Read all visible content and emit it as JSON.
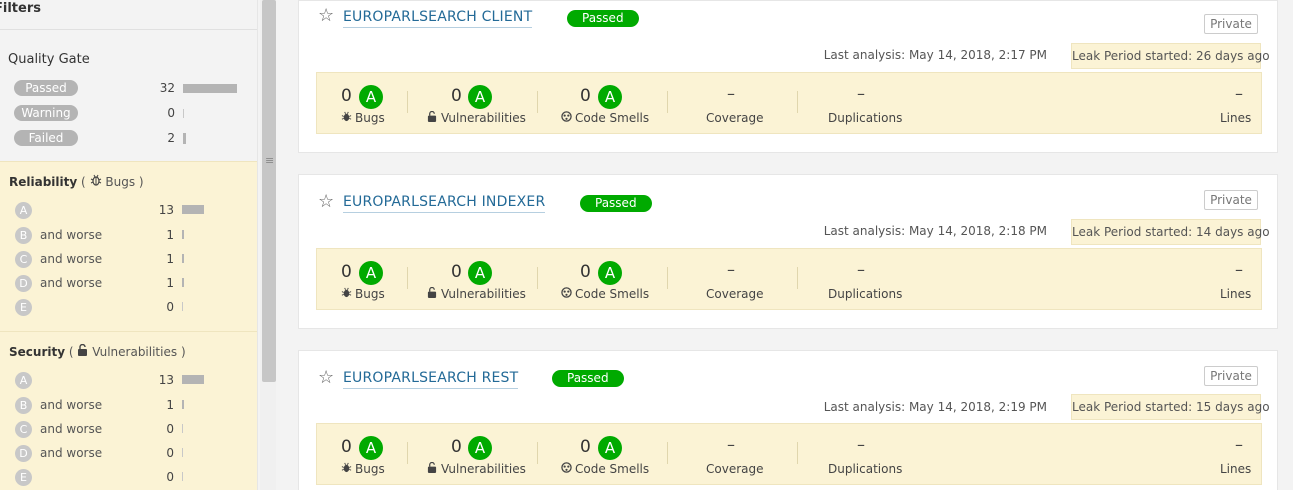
{
  "sidebar": {
    "filters_title": "Filters",
    "quality_gate": {
      "title": "Quality Gate",
      "items": [
        {
          "label": "Passed",
          "count": "32",
          "fraction": 1.0
        },
        {
          "label": "Warning",
          "count": "0",
          "fraction": 0.0
        },
        {
          "label": "Failed",
          "count": "2",
          "fraction": 0.06
        }
      ]
    },
    "reliability": {
      "title": "Reliability",
      "paren_open": "(",
      "sub": "Bugs",
      "paren_close": ")",
      "icon": "bug-icon",
      "rows": [
        {
          "grade": "A",
          "label": "",
          "count": "13",
          "fraction": 1.0
        },
        {
          "grade": "B",
          "label": "and worse",
          "count": "1",
          "fraction": 0.08
        },
        {
          "grade": "C",
          "label": "and worse",
          "count": "1",
          "fraction": 0.08
        },
        {
          "grade": "D",
          "label": "and worse",
          "count": "1",
          "fraction": 0.08
        },
        {
          "grade": "E",
          "label": "",
          "count": "0",
          "fraction": 0.0
        }
      ]
    },
    "security": {
      "title": "Security",
      "paren_open": "(",
      "sub": "Vulnerabilities",
      "paren_close": ")",
      "icon": "lock-icon",
      "rows": [
        {
          "grade": "A",
          "label": "",
          "count": "13",
          "fraction": 1.0
        },
        {
          "grade": "B",
          "label": "and worse",
          "count": "1",
          "fraction": 0.08
        },
        {
          "grade": "C",
          "label": "and worse",
          "count": "0",
          "fraction": 0.0
        },
        {
          "grade": "D",
          "label": "and worse",
          "count": "0",
          "fraction": 0.0
        },
        {
          "grade": "E",
          "label": "",
          "count": "0",
          "fraction": 0.0
        }
      ]
    }
  },
  "projects": [
    {
      "name": "EUROPARLSEARCH CLIENT",
      "status": "Passed",
      "visibility": "Private",
      "last_analysis": "Last analysis: May 14, 2018, 2:17 PM",
      "leak_period": "Leak Period started: 26 days ago",
      "bugs": "0",
      "bugs_grade": "A",
      "bugs_label": "Bugs",
      "vulns": "0",
      "vulns_grade": "A",
      "vulns_label": "Vulnerabilities",
      "smells": "0",
      "smells_grade": "A",
      "smells_label": "Code Smells",
      "coverage": "–",
      "coverage_label": "Coverage",
      "duplications": "–",
      "duplications_label": "Duplications",
      "lines": "–",
      "lines_label": "Lines"
    },
    {
      "name": "EUROPARLSEARCH INDEXER",
      "status": "Passed",
      "visibility": "Private",
      "last_analysis": "Last analysis: May 14, 2018, 2:18 PM",
      "leak_period": "Leak Period started: 14 days ago",
      "bugs": "0",
      "bugs_grade": "A",
      "bugs_label": "Bugs",
      "vulns": "0",
      "vulns_grade": "A",
      "vulns_label": "Vulnerabilities",
      "smells": "0",
      "smells_grade": "A",
      "smells_label": "Code Smells",
      "coverage": "–",
      "coverage_label": "Coverage",
      "duplications": "–",
      "duplications_label": "Duplications",
      "lines": "–",
      "lines_label": "Lines"
    },
    {
      "name": "EUROPARLSEARCH REST",
      "status": "Passed",
      "visibility": "Private",
      "last_analysis": "Last analysis: May 14, 2018, 2:19 PM",
      "leak_period": "Leak Period started: 15 days ago",
      "bugs": "0",
      "bugs_grade": "A",
      "bugs_label": "Bugs",
      "vulns": "0",
      "vulns_grade": "A",
      "vulns_label": "Vulnerabilities",
      "smells": "0",
      "smells_grade": "A",
      "smells_label": "Code Smells",
      "coverage": "–",
      "coverage_label": "Coverage",
      "duplications": "–",
      "duplications_label": "Duplications",
      "lines": "–",
      "lines_label": "Lines"
    }
  ],
  "colors": {
    "passed": "#00aa00",
    "link": "#236a97",
    "leak_bg": "#fbf3d5",
    "facet_bg": "#fbf3d5"
  },
  "icons": {
    "favorite": "star-icon",
    "bug": "bug-icon",
    "lock": "lock-icon",
    "code_smell": "code-smell-icon"
  }
}
